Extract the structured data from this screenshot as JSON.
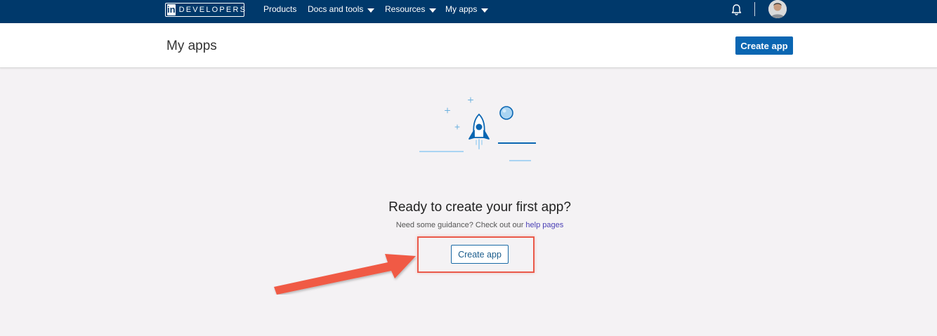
{
  "nav": {
    "logo_text": "DEVELOPERS",
    "logo_in": "in",
    "items": [
      {
        "label": "Products",
        "dropdown": false
      },
      {
        "label": "Docs and tools",
        "dropdown": true
      },
      {
        "label": "Resources",
        "dropdown": true
      },
      {
        "label": "My apps",
        "dropdown": true
      }
    ],
    "icons": [
      "bell-icon",
      "avatar"
    ]
  },
  "header": {
    "title": "My apps",
    "create_label": "Create app"
  },
  "empty_state": {
    "title": "Ready to create your first app?",
    "subtitle_prefix": "Need some guidance? Check out our ",
    "help_link": "help pages",
    "create_label": "Create app"
  },
  "colors": {
    "nav_bg": "#00396b",
    "primary": "#0a66b2",
    "highlight": "#ea5a4a",
    "page_bg": "#f4f2f4"
  }
}
